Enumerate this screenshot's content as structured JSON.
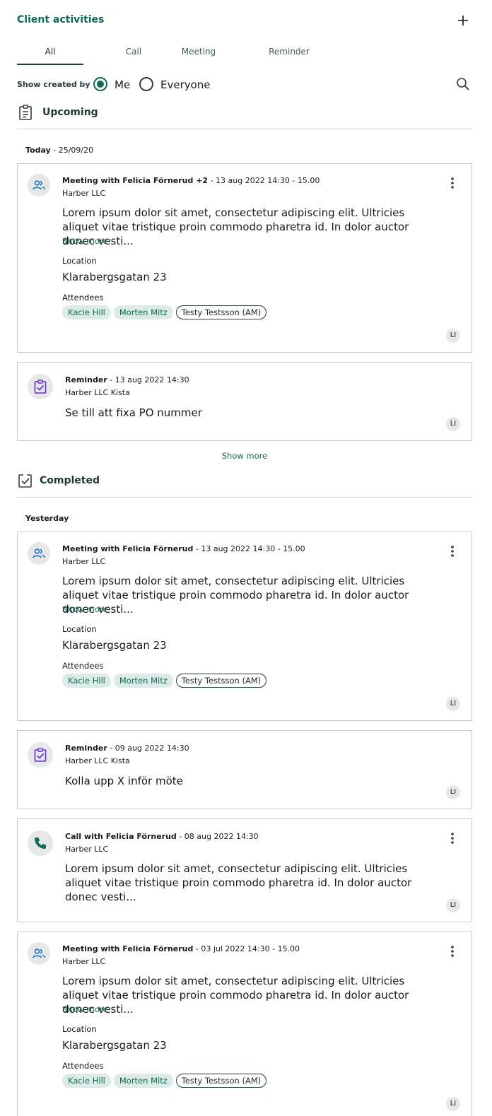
{
  "header": {
    "title": "Client activities",
    "add_icon": "plus-icon"
  },
  "tabs": [
    {
      "label": "All",
      "active": true
    },
    {
      "label": "Call",
      "active": false
    },
    {
      "label": "Meeting",
      "active": false
    },
    {
      "label": "Reminder",
      "active": false
    }
  ],
  "filter": {
    "label": "Show created by",
    "options": [
      {
        "label": "Me",
        "selected": true
      },
      {
        "label": "Everyone",
        "selected": false
      }
    ],
    "search_icon": "search-icon"
  },
  "colors": {
    "accent": "#0f6b57",
    "chip_bg": "#dcebe7",
    "meeting_icon": "#1f6fd1",
    "reminder_icon": "#6b2bd9",
    "call_icon": "#0f6b57"
  },
  "upcoming": {
    "title": "Upcoming",
    "day_bold": "Today",
    "day_rest": " - 25/09/20",
    "show_more": "Show more",
    "meeting": {
      "title": "Meeting with Felicia Förnerud +2",
      "time": " - 13 aug 2022 14:30 - 15.00",
      "company": "Harber LLC",
      "body": "Lorem ipsum dolor sit amet, consectetur adipiscing elit. Ultricies aliquet vitae tristique proin commodo pharetra id. In dolor auctor donec vesti...",
      "show_more": "Show more",
      "location_label": "Location",
      "location": "Klarabergsgatan 23",
      "attendees_label": "Attendees",
      "attendees": [
        "Kacie Hill",
        "Morten Mitz",
        "Testy Testsson (AM)"
      ],
      "owner": "LI"
    },
    "reminder": {
      "title": "Reminder",
      "time": " - 13 aug 2022 14:30",
      "company": "Harber LLC Kista",
      "body": "Se till att fixa PO nummer",
      "owner": "LI"
    }
  },
  "completed": {
    "title": "Completed",
    "day_bold": "Yesterday",
    "meeting1": {
      "title": "Meeting with Felicia Förnerud",
      "time": " - 13 aug 2022 14:30 - 15.00",
      "company": "Harber LLC",
      "body": "Lorem ipsum dolor sit amet, consectetur adipiscing elit. Ultricies aliquet vitae tristique proin commodo pharetra id. In dolor auctor donec vesti...",
      "show_more": "Show more",
      "location_label": "Location",
      "location": "Klarabergsgatan 23",
      "attendees_label": "Attendees",
      "attendees": [
        "Kacie Hill",
        "Morten Mitz",
        "Testy Testsson (AM)"
      ],
      "owner": "LI"
    },
    "reminder": {
      "title": "Reminder",
      "time": " - 09 aug 2022 14:30",
      "company": "Harber LLC Kista",
      "body": "Kolla upp X inför möte",
      "owner": "LI"
    },
    "call": {
      "title": "Call with Felicia Förnerud",
      "time": " - 08 aug 2022 14:30",
      "company": "Harber LLC",
      "body": "Lorem ipsum dolor sit amet, consectetur adipiscing elit. Ultricies aliquet vitae tristique proin commodo pharetra id. In dolor auctor donec vesti...",
      "owner": "LI"
    },
    "meeting2": {
      "title": "Meeting with Felicia Förnerud",
      "time": " - 03 jul 2022 14:30 - 15.00",
      "company": "Harber LLC",
      "body": "Lorem ipsum dolor sit amet, consectetur adipiscing elit. Ultricies aliquet vitae tristique proin commodo pharetra id. In dolor auctor donec vesti...",
      "show_more": "Show more",
      "location_label": "Location",
      "location": "Klarabergsgatan 23",
      "attendees_label": "Attendees",
      "attendees": [
        "Kacie Hill",
        "Morten Mitz",
        "Testy Testsson (AM)"
      ],
      "owner": "LI"
    }
  }
}
